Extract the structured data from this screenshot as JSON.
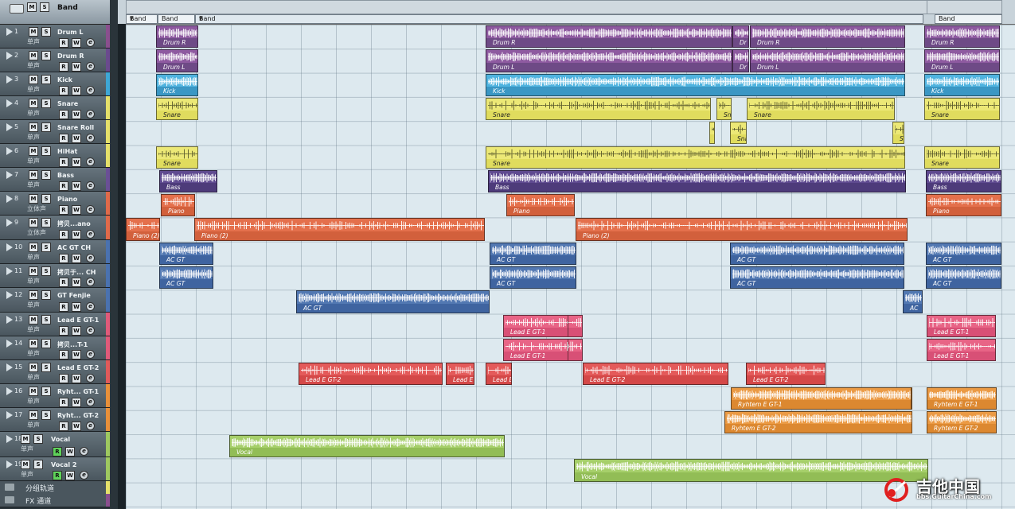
{
  "header": {
    "title": "Band",
    "m": "M",
    "s": "S"
  },
  "buttons": {
    "m": "M",
    "s": "S",
    "r": "R",
    "w": "W",
    "e": "e"
  },
  "tracks": [
    {
      "num": "1",
      "name": "Drum L",
      "mode": "单声",
      "color": "#8a4f8e"
    },
    {
      "num": "2",
      "name": "Drum R",
      "mode": "单声",
      "color": "#6a4a8e"
    },
    {
      "num": "3",
      "name": "Kick",
      "mode": "单声",
      "color": "#3ea7d6"
    },
    {
      "num": "4",
      "name": "Snare",
      "mode": "单声",
      "color": "#e5e06a"
    },
    {
      "num": "5",
      "name": "Snare Roll",
      "mode": "单声",
      "color": "#e5e06a"
    },
    {
      "num": "6",
      "name": "HiHat",
      "mode": "单声",
      "color": "#e5e06a"
    },
    {
      "num": "7",
      "name": "Bass",
      "mode": "单声",
      "color": "#6a4f96"
    },
    {
      "num": "8",
      "name": "Piano",
      "mode": "立体声",
      "color": "#e06a4a"
    },
    {
      "num": "9",
      "name": "拷贝...ano",
      "mode": "立体声",
      "color": "#e06a4a"
    },
    {
      "num": "10",
      "name": "AC GT CH",
      "mode": "单声",
      "color": "#4a72b0"
    },
    {
      "num": "11",
      "name": "拷贝于... CH",
      "mode": "单声",
      "color": "#4a72b0"
    },
    {
      "num": "12",
      "name": "GT Fenjie",
      "mode": "单声",
      "color": "#4a72b0"
    },
    {
      "num": "13",
      "name": "Lead E GT-1",
      "mode": "单声",
      "color": "#e05a7a"
    },
    {
      "num": "14",
      "name": "拷贝...T-1",
      "mode": "单声",
      "color": "#e05a7a"
    },
    {
      "num": "15",
      "name": "Lead E GT-2",
      "mode": "单声",
      "color": "#e05a5a"
    },
    {
      "num": "16",
      "name": "Ryht... GT-1",
      "mode": "单声",
      "color": "#e8903a"
    },
    {
      "num": "17",
      "name": "Ryht... GT-2",
      "mode": "单声",
      "color": "#e8903a"
    },
    {
      "num": "18",
      "name": "Vocal",
      "mode": "单声",
      "color": "#9ec860"
    },
    {
      "num": "19",
      "name": "Vocal 2",
      "mode": "单声",
      "color": "#9ec860"
    }
  ],
  "groups": [
    {
      "label": "分组轨道",
      "color": "#e5e06a"
    },
    {
      "label": "FX 通道",
      "color": "#8a4f8e"
    }
  ],
  "markers": [
    "Band",
    "Band",
    "Band",
    "Band"
  ],
  "clip_colors": {
    "drum": "#8e5aa0",
    "drum_band": "#6e4a86",
    "kick": "#4fb3df",
    "kick_band": "#3a97c4",
    "snare": "#ece876",
    "snare_band": "#e0dc5e",
    "bass": "#5f4a90",
    "bass_band": "#4d3b7a",
    "piano": "#e4704c",
    "piano_band": "#d2603c",
    "acgt": "#5278b2",
    "acgt_band": "#3f64a0",
    "lead1": "#e86486",
    "lead1_band": "#d85076",
    "lead2": "#e45a5a",
    "lead2_band": "#d44848",
    "ryhtem": "#eb9a44",
    "ryhtem_band": "#dc8830",
    "vocal": "#a6cf6a",
    "vocal_band": "#92bd56"
  },
  "clips": [
    {
      "row": 0,
      "label": "Drum R",
      "c": "drum"
    },
    {
      "row": 1,
      "label": "Drum L",
      "c": "drum"
    },
    {
      "row": 2,
      "label": "Kick",
      "c": "kick"
    },
    {
      "row": 3,
      "label": "Snare",
      "c": "snare"
    },
    {
      "row": 5,
      "label": "Snare",
      "c": "snare"
    },
    {
      "row": 6,
      "label": "Bass",
      "c": "bass"
    },
    {
      "row": 7,
      "label": "Piano",
      "c": "piano"
    },
    {
      "row": 8,
      "label": "Piano (2)",
      "c": "piano"
    },
    {
      "row": 9,
      "label": "AC GT",
      "c": "acgt"
    },
    {
      "row": 10,
      "label": "AC GT",
      "c": "acgt"
    },
    {
      "row": 11,
      "label": "AC GT",
      "c": "acgt"
    },
    {
      "row": 12,
      "label": "Lead E GT-1",
      "c": "lead1"
    },
    {
      "row": 13,
      "label": "Lead E GT-1",
      "c": "lead1"
    },
    {
      "row": 14,
      "label": "Lead E GT-2",
      "c": "lead2"
    },
    {
      "row": 15,
      "label": "Ryhtem E GT-1",
      "c": "ryhtem"
    },
    {
      "row": 16,
      "label": "Ryhtem E GT-2",
      "c": "ryhtem"
    },
    {
      "row": 17,
      "label": "Vocal",
      "c": "vocal"
    },
    {
      "row": 18,
      "label": "Vocal",
      "c": "vocal"
    },
    {
      "row": 0,
      "label": "Drum R",
      "c": "drum"
    },
    {
      "row": 0,
      "label": "Dr",
      "c": "drum"
    },
    {
      "row": 0,
      "label": "Drum R",
      "c": "drum"
    },
    {
      "row": 1,
      "label": "Drum L",
      "c": "drum"
    },
    {
      "row": 1,
      "label": "Dr",
      "c": "drum"
    },
    {
      "row": 1,
      "label": "Drum L",
      "c": "drum"
    },
    {
      "row": 2,
      "label": "Kick",
      "c": "kick"
    },
    {
      "row": 3,
      "label": "Snare",
      "c": "snare"
    },
    {
      "row": 3,
      "label": "Sn",
      "c": "snare"
    },
    {
      "row": 3,
      "label": "Snare",
      "c": "snare"
    },
    {
      "row": 4,
      "label": "",
      "c": "snare"
    },
    {
      "row": 4,
      "label": "Sna",
      "c": "snare"
    },
    {
      "row": 4,
      "label": "S",
      "c": "snare"
    },
    {
      "row": 5,
      "label": "Snare",
      "c": "snare"
    },
    {
      "row": 6,
      "label": "Bass",
      "c": "bass"
    },
    {
      "row": 7,
      "label": "Piano",
      "c": "piano"
    },
    {
      "row": 8,
      "label": "Piano (2)",
      "c": "piano"
    },
    {
      "row": 8,
      "label": "Piano (2)",
      "c": "piano"
    },
    {
      "row": 9,
      "label": "AC GT",
      "c": "acgt"
    },
    {
      "row": 9,
      "label": "AC GT",
      "c": "acgt"
    },
    {
      "row": 10,
      "label": "AC GT",
      "c": "acgt"
    },
    {
      "row": 10,
      "label": "AC GT",
      "c": "acgt"
    },
    {
      "row": 11,
      "label": "AC GT",
      "c": "acgt"
    },
    {
      "row": 11,
      "label": "AC",
      "c": "acgt"
    },
    {
      "row": 12,
      "label": "Lead E GT-1",
      "c": "lead1"
    },
    {
      "row": 13,
      "label": "Lead E GT-1",
      "c": "lead1"
    },
    {
      "row": 14,
      "label": "Lead E",
      "c": "lead2"
    },
    {
      "row": 14,
      "label": "Lead E",
      "c": "lead2"
    },
    {
      "row": 14,
      "label": "Lead E GT-2",
      "c": "lead2"
    },
    {
      "row": 14,
      "label": "Lead E GT-2",
      "c": "lead2"
    },
    {
      "row": 15,
      "label": "Ryhtem E GT-1",
      "c": "ryhtem"
    },
    {
      "row": 16,
      "label": "Ryhtem E GT-2",
      "c": "ryhtem"
    },
    {
      "row": 0,
      "label": "Drum R",
      "c": "drum"
    },
    {
      "row": 1,
      "label": "Drum L",
      "c": "drum"
    },
    {
      "row": 2,
      "label": "Kick",
      "c": "kick"
    },
    {
      "row": 3,
      "label": "Snare",
      "c": "snare"
    },
    {
      "row": 5,
      "label": "Snare",
      "c": "snare"
    },
    {
      "row": 6,
      "label": "Bass",
      "c": "bass"
    },
    {
      "row": 7,
      "label": "Piano",
      "c": "piano"
    },
    {
      "row": 9,
      "label": "AC GT",
      "c": "acgt"
    },
    {
      "row": 10,
      "label": "AC GT",
      "c": "acgt"
    },
    {
      "row": 12,
      "label": "Lead E GT-1",
      "c": "lead1"
    },
    {
      "row": 13,
      "label": "Lead E GT-1",
      "c": "lead1"
    },
    {
      "row": 15,
      "label": "Ryhtem E GT-1",
      "c": "ryhtem"
    },
    {
      "row": 16,
      "label": "Ryhtem E GT-2",
      "c": "ryhtem"
    }
  ],
  "watermark": {
    "title": "吉他中国",
    "url": "bbs.GuitarChina.com"
  }
}
